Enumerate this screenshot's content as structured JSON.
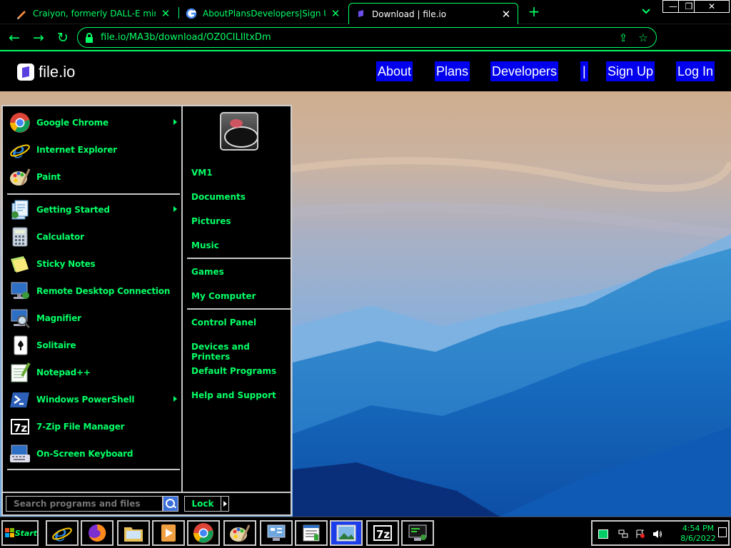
{
  "browser": {
    "tabs": [
      {
        "title": "Craiyon, formerly DALL-E mini",
        "favicon": "pencil-icon"
      },
      {
        "title": "AboutPlansDevelopers|Sign UpLog",
        "favicon": "google-icon"
      },
      {
        "title": "Download | file.io",
        "favicon": "fileio-icon",
        "active": true
      }
    ],
    "new_tab": "+",
    "url": "file.io/MA3b/download/OZ0CILIltxDm"
  },
  "site": {
    "logo_text": "file.io",
    "nav": [
      "About",
      "Plans",
      "Developers",
      "|",
      "Sign Up",
      "Log In"
    ]
  },
  "start_menu": {
    "pinned": [
      {
        "label": "Google Chrome",
        "icon": "chrome-icon",
        "arrow": true
      },
      {
        "label": "Internet Explorer",
        "icon": "ie-icon"
      },
      {
        "label": "Paint",
        "icon": "paint-icon"
      }
    ],
    "recent": [
      {
        "label": "Getting Started",
        "icon": "getting-started-icon",
        "arrow": true
      },
      {
        "label": "Calculator",
        "icon": "calculator-icon"
      },
      {
        "label": "Sticky Notes",
        "icon": "sticky-notes-icon"
      },
      {
        "label": "Remote Desktop Connection",
        "icon": "remote-desktop-icon"
      },
      {
        "label": "Magnifier",
        "icon": "magnifier-icon"
      },
      {
        "label": "Solitaire",
        "icon": "solitaire-icon"
      },
      {
        "label": "Notepad++",
        "icon": "notepadpp-icon"
      },
      {
        "label": "Windows PowerShell",
        "icon": "powershell-icon",
        "arrow": true
      },
      {
        "label": "7-Zip File Manager",
        "icon": "7zip-icon"
      },
      {
        "label": "On-Screen Keyboard",
        "icon": "keyboard-icon"
      }
    ],
    "right_group1": [
      "VM1",
      "Documents",
      "Pictures",
      "Music"
    ],
    "right_group2": [
      "Games",
      "My Computer"
    ],
    "right_group3": [
      "Control Panel",
      "Devices and Printers",
      "Default Programs",
      "Help and Support"
    ],
    "search_placeholder": "Search programs and files",
    "lock_label": "Lock"
  },
  "taskbar": {
    "start_label": "Start",
    "apps": [
      "ie-icon",
      "firefox-icon",
      "explorer-icon",
      "media-player-icon",
      "chrome-icon",
      "paint-icon",
      "control-panel-icon",
      "notepad-icon",
      "photo-viewer-icon",
      "7zip-icon",
      "remote-terminal-icon"
    ],
    "active_app_index": 8,
    "time": "4:54 PM",
    "date": "8/6/2022"
  },
  "colors": {
    "accent": "#00ff66",
    "link_bg": "#0000ee",
    "fileio_purple": "#5b3fe0"
  }
}
